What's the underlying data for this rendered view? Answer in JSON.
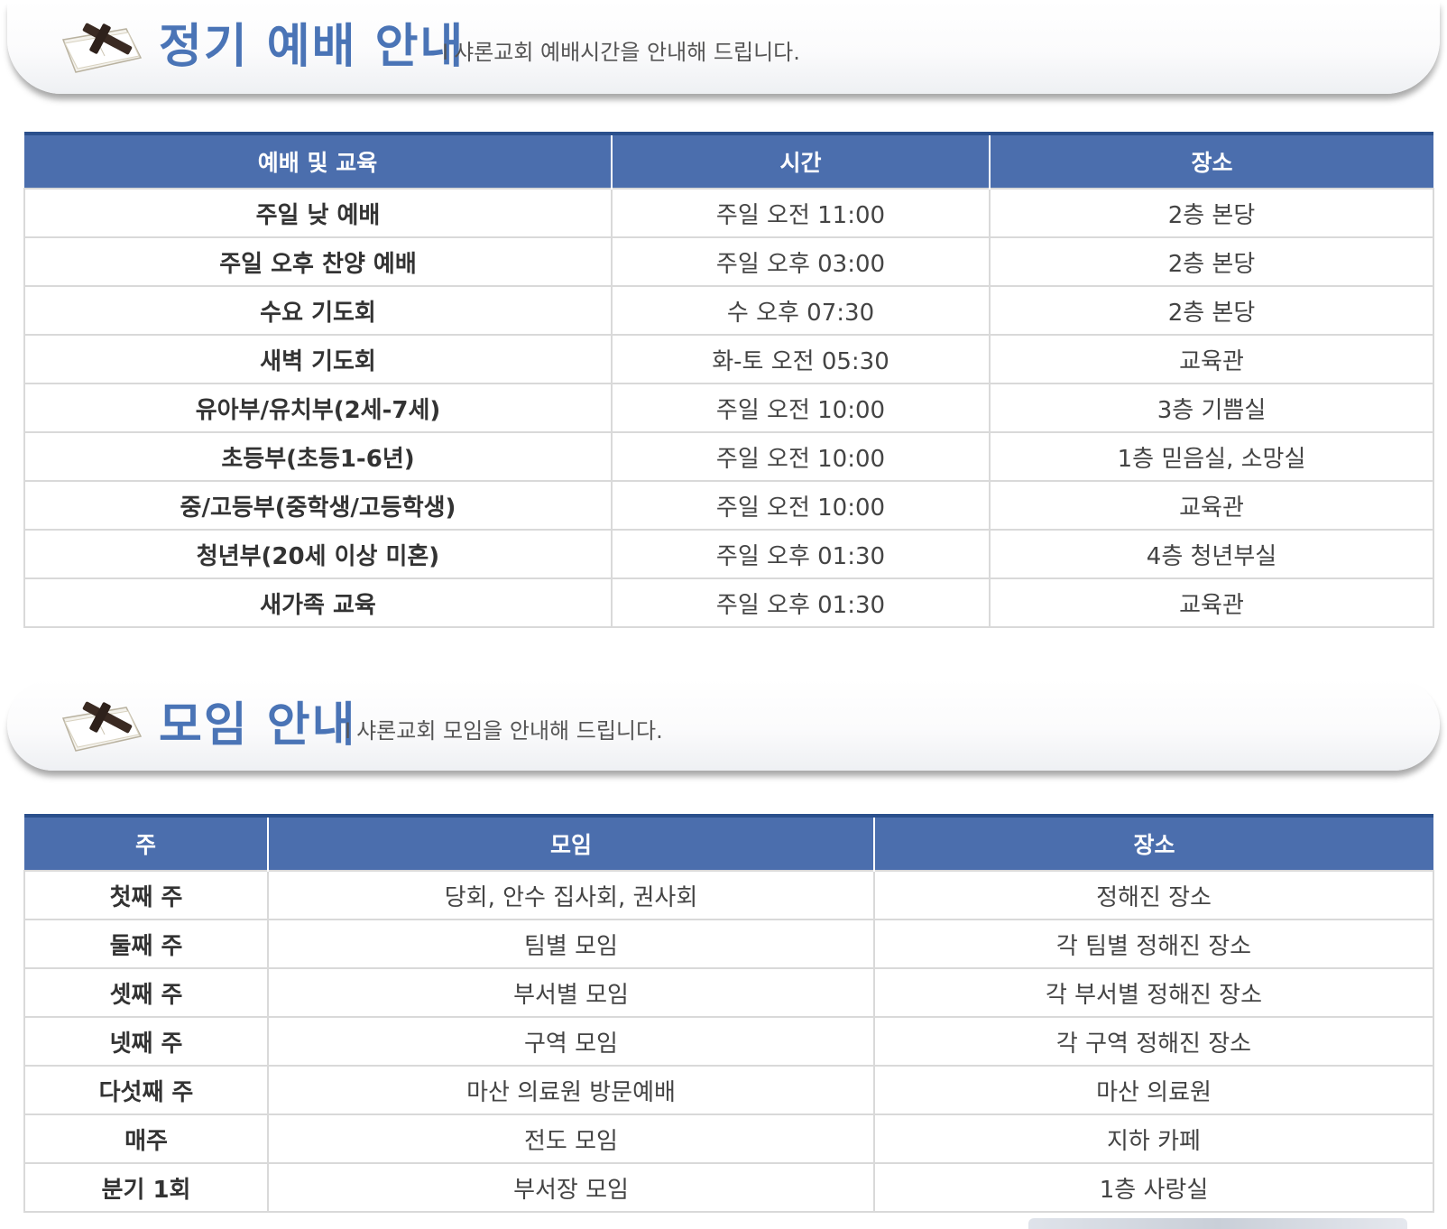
{
  "worship_section": {
    "title": "정기 예배 안내",
    "separator": "I",
    "subtitle": "샤론교회 예배시간을 안내해 드립니다.",
    "icon": "bible-cross-icon",
    "columns": [
      "예배 및 교육",
      "시간",
      "장소"
    ],
    "rows": [
      {
        "name": "주일 낮 예배",
        "time": "주일 오전 11:00",
        "place": "2층 본당"
      },
      {
        "name": "주일 오후 찬양 예배",
        "time": "주일 오후 03:00",
        "place": "2층 본당"
      },
      {
        "name": "수요 기도회",
        "time": "수 오후 07:30",
        "place": "2층 본당"
      },
      {
        "name": "새벽 기도회",
        "time": "화-토 오전 05:30",
        "place": "교육관"
      },
      {
        "name": "유아부/유치부(2세-7세)",
        "time": "주일 오전 10:00",
        "place": "3층 기쁨실"
      },
      {
        "name": "초등부(초등1-6년)",
        "time": "주일 오전 10:00",
        "place": "1층 믿음실, 소망실"
      },
      {
        "name": "중/고등부(중학생/고등학생)",
        "time": "주일 오전 10:00",
        "place": "교육관"
      },
      {
        "name": "청년부(20세 이상 미혼)",
        "time": "주일 오후 01:30",
        "place": "4층 청년부실"
      },
      {
        "name": "새가족 교육",
        "time": "주일 오후 01:30",
        "place": "교육관"
      }
    ]
  },
  "meeting_section": {
    "title": "모임 안내",
    "separator": "I",
    "subtitle": "샤론교회 모임을 안내해 드립니다.",
    "icon": "bible-cross-icon",
    "columns": [
      "주",
      "모임",
      "장소"
    ],
    "rows": [
      {
        "week": "첫째 주",
        "meeting": "당회, 안수 집사회, 권사회",
        "place": "정해진 장소"
      },
      {
        "week": "둘째 주",
        "meeting": "팀별 모임",
        "place": "각 팀별 정해진 장소"
      },
      {
        "week": "셋째 주",
        "meeting": "부서별 모임",
        "place": "각 부서별 정해진 장소"
      },
      {
        "week": "넷째 주",
        "meeting": "구역 모임",
        "place": "각 구역 정해진 장소"
      },
      {
        "week": "다섯째 주",
        "meeting": "마산 의료원 방문예배",
        "place": "마산 의료원"
      },
      {
        "week": "매주",
        "meeting": "전도 모임",
        "place": "지하 카페"
      },
      {
        "week": "분기 1회",
        "meeting": "부서장 모임",
        "place": "1층 사랑실"
      }
    ]
  },
  "colors": {
    "title_blue": "#4a74b6",
    "header_bg": "#4b6ead",
    "header_top_border": "#2a4f8c",
    "cell_border": "#d9d9d9"
  }
}
